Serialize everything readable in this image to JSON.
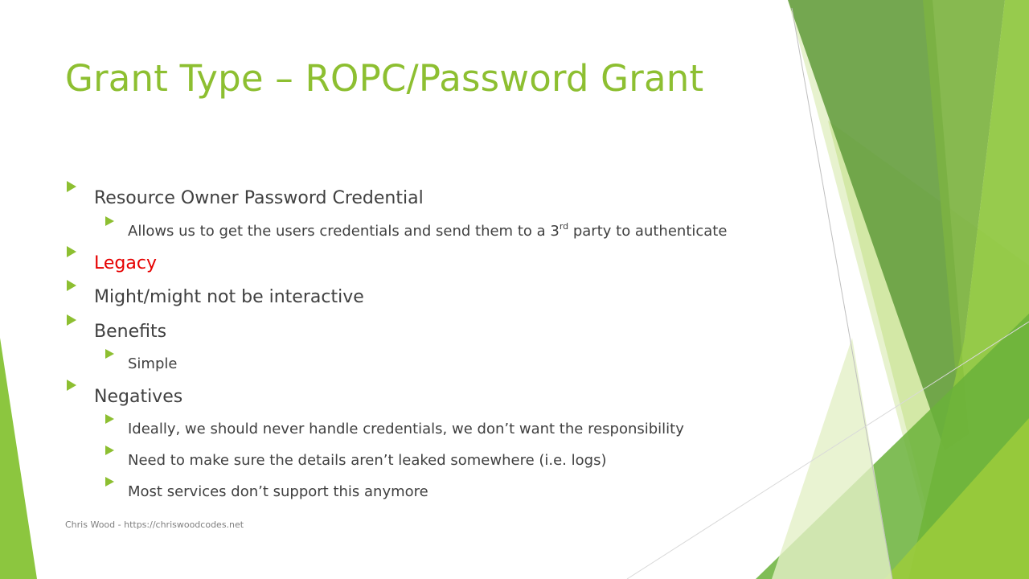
{
  "slide": {
    "title": "Grant Type – ROPC/Password Grant",
    "bullets": [
      {
        "level": 1,
        "text": "Resource Owner Password Credential"
      },
      {
        "level": 2,
        "text_before": "Allows us to get the users credentials and send them to a 3",
        "superscript": "rd",
        "text_after": " party to authenticate"
      },
      {
        "level": 1,
        "text": "Legacy",
        "color": "#e60000"
      },
      {
        "level": 1,
        "text": "Might/might not be interactive"
      },
      {
        "level": 1,
        "text": "Benefits"
      },
      {
        "level": 2,
        "text": "Simple"
      },
      {
        "level": 1,
        "text": "Negatives"
      },
      {
        "level": 2,
        "text": "Ideally, we should never handle credentials, we don’t want the responsibility"
      },
      {
        "level": 2,
        "text": "Need to make sure the details aren’t leaked somewhere (i.e. logs)"
      },
      {
        "level": 2,
        "text": "Most services don’t support this anymore"
      }
    ],
    "footer": "Chris Wood - https://chriswoodcodes.net"
  },
  "theme": {
    "accent": "#8dbf31",
    "text": "#404040",
    "highlight": "#e60000"
  }
}
